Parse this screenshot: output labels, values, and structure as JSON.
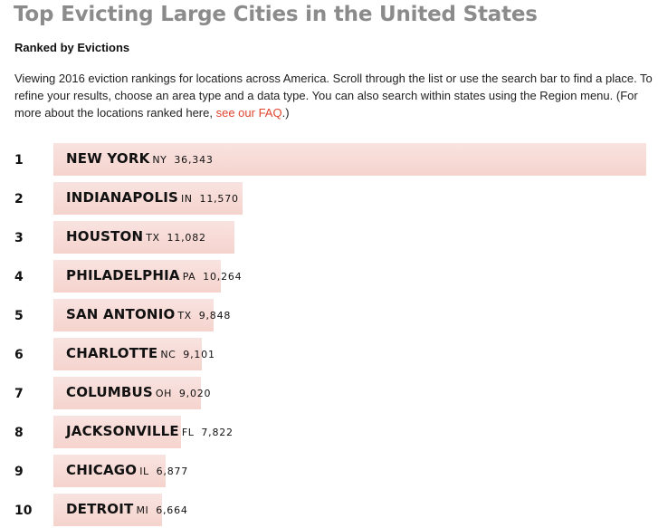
{
  "header": {
    "title": "Top Evicting Large Cities in the United States",
    "subtitle": "Ranked by Evictions",
    "description": "Viewing 2016 eviction rankings for locations across America. Scroll through the list or use the search bar to find a place. To refine your results, choose an area type and a data type. You can also search within states using the Region menu. (For more about the locations ranked here, ",
    "link_text": "see our FAQ",
    "description_end": ".)"
  },
  "colors": {
    "title": "#8b8b8b",
    "link": "#e0452f",
    "bar_top": "#f8e3e0",
    "bar_bottom": "#f6d3cd"
  },
  "chart_data": {
    "type": "bar",
    "orientation": "horizontal",
    "title": "Top Evicting Large Cities in the United States",
    "subtitle": "Ranked by Evictions",
    "xlabel": "",
    "ylabel": "",
    "grid": false,
    "xlim": [
      0,
      36343
    ],
    "categories": [
      "NEW YORK",
      "INDIANAPOLIS",
      "HOUSTON",
      "PHILADELPHIA",
      "SAN ANTONIO",
      "CHARLOTTE",
      "COLUMBUS",
      "JACKSONVILLE",
      "CHICAGO",
      "DETROIT"
    ],
    "rows": [
      {
        "rank": "1",
        "city": "NEW YORK",
        "state": "NY",
        "value": 36343,
        "value_label": "36,343"
      },
      {
        "rank": "2",
        "city": "INDIANAPOLIS",
        "state": "IN",
        "value": 11570,
        "value_label": "11,570"
      },
      {
        "rank": "3",
        "city": "HOUSTON",
        "state": "TX",
        "value": 11082,
        "value_label": "11,082"
      },
      {
        "rank": "4",
        "city": "PHILADELPHIA",
        "state": "PA",
        "value": 10264,
        "value_label": "10,264"
      },
      {
        "rank": "5",
        "city": "SAN ANTONIO",
        "state": "TX",
        "value": 9848,
        "value_label": "9,848"
      },
      {
        "rank": "6",
        "city": "CHARLOTTE",
        "state": "NC",
        "value": 9101,
        "value_label": "9,101"
      },
      {
        "rank": "7",
        "city": "COLUMBUS",
        "state": "OH",
        "value": 9020,
        "value_label": "9,020"
      },
      {
        "rank": "8",
        "city": "JACKSONVILLE",
        "state": "FL",
        "value": 7822,
        "value_label": "7,822"
      },
      {
        "rank": "9",
        "city": "CHICAGO",
        "state": "IL",
        "value": 6877,
        "value_label": "6,877"
      },
      {
        "rank": "10",
        "city": "DETROIT",
        "state": "MI",
        "value": 6664,
        "value_label": "6,664"
      }
    ],
    "series": [
      {
        "name": "Evictions",
        "values": [
          36343,
          11570,
          11082,
          10264,
          9848,
          9101,
          9020,
          7822,
          6877,
          6664
        ]
      }
    ]
  }
}
